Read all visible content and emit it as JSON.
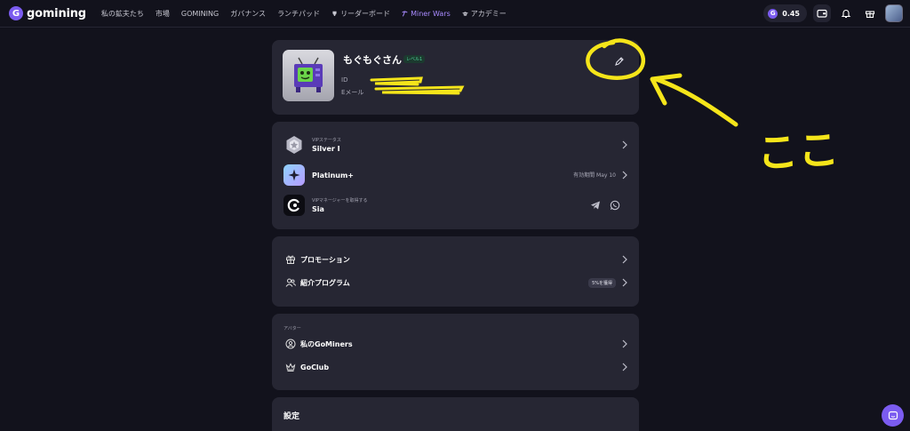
{
  "nav": {
    "brand": "gomining",
    "links": [
      "私の鉱夫たち",
      "市場",
      "GOMINING",
      "ガバナンス",
      "ランチパッド",
      "リーダーボード",
      "Miner Wars",
      "アカデミー"
    ],
    "balance": "0.45",
    "accent": "#7b5cf0"
  },
  "profile": {
    "name": "もぐもぐさん",
    "level": "レベル1",
    "id_label": "ID",
    "email_label": "Eメール"
  },
  "vip": {
    "status_small": "VIPステータス",
    "status": "Silver I",
    "plan": "Platinum+",
    "plan_expiry": "有効期間 May 10",
    "manager_small": "VIPマネージャーを取得する",
    "manager": "Sia"
  },
  "menu": {
    "promotion": "プロモーション",
    "referral": "紹介プログラム",
    "referral_badge": "5%を獲得"
  },
  "avatar_section": {
    "title": "アバター",
    "my_miners": "私のGoMiners",
    "goclub": "GoClub"
  },
  "settings": {
    "title": "設定"
  },
  "annotation": {
    "text": "ここ",
    "color": "#f5e51a"
  }
}
